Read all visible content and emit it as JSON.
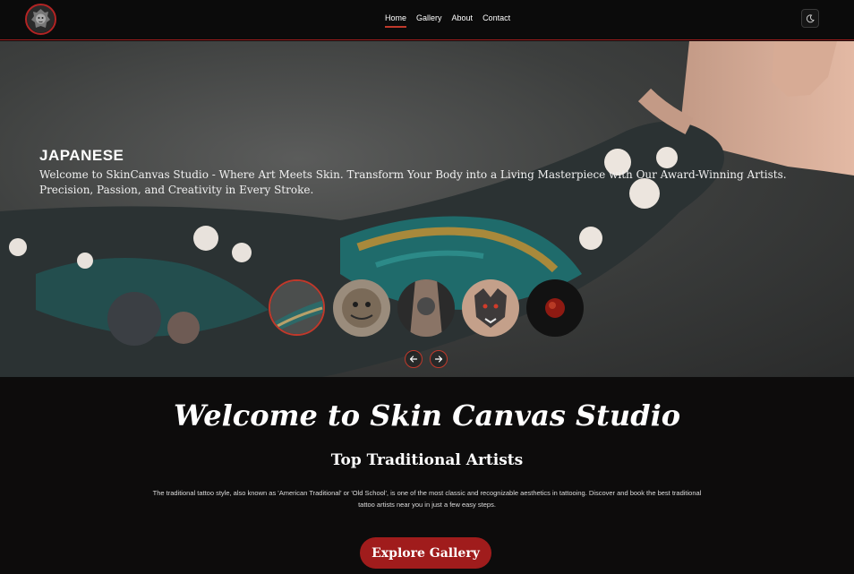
{
  "header": {
    "logo_alt": "SkinCanvas Studio logo",
    "nav": [
      {
        "label": "Home",
        "active": true
      },
      {
        "label": "Gallery",
        "active": false
      },
      {
        "label": "About",
        "active": false
      },
      {
        "label": "Contact",
        "active": false
      }
    ],
    "theme_toggle_icon": "moon-icon"
  },
  "hero": {
    "title": "JAPANESE",
    "description": "Welcome to SkinCanvas Studio - Where Art Meets Skin. Transform Your Body into a Living Masterpiece with Our Award-Winning Artists. Precision, Passion, and Creativity in Every Stroke.",
    "thumbnails": [
      "japanese",
      "tiger",
      "realism",
      "wolf",
      "blackwork"
    ],
    "active_thumbnail": 0,
    "prev_icon": "arrow-left-icon",
    "next_icon": "arrow-right-icon"
  },
  "main": {
    "welcome": "Welcome to Skin Canvas Studio",
    "subtitle": "Top Traditional Artists",
    "paragraph": "The traditional tattoo style, also known as 'American Traditional' or 'Old School', is one of the most classic and recognizable aesthetics in tattooing. Discover and book the best traditional tattoo artists near you in just a few easy steps.",
    "cta_label": "Explore Gallery"
  },
  "colors": {
    "accent": "#a01c1c",
    "background": "#0d0c0c"
  }
}
